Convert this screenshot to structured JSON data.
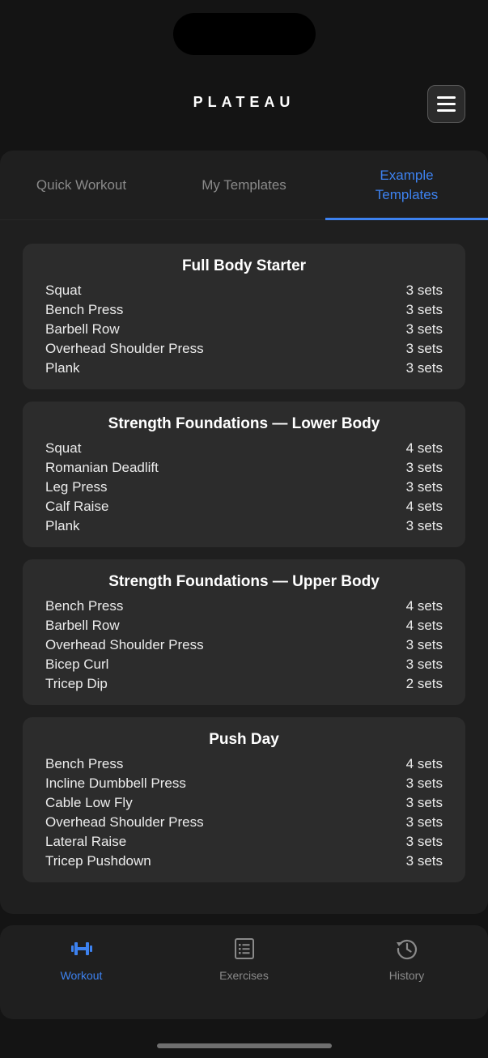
{
  "header": {
    "title": "PLATEAU"
  },
  "tabs": [
    {
      "label": "Quick Workout"
    },
    {
      "label": "My Templates"
    },
    {
      "label": "Example Templates"
    }
  ],
  "templates": [
    {
      "title": "Full Body Starter",
      "exercises": [
        {
          "name": "Squat",
          "sets": "3 sets"
        },
        {
          "name": "Bench Press",
          "sets": "3 sets"
        },
        {
          "name": "Barbell Row",
          "sets": "3 sets"
        },
        {
          "name": "Overhead Shoulder Press",
          "sets": "3 sets"
        },
        {
          "name": "Plank",
          "sets": "3 sets"
        }
      ]
    },
    {
      "title": "Strength Foundations — Lower Body",
      "exercises": [
        {
          "name": "Squat",
          "sets": "4 sets"
        },
        {
          "name": "Romanian Deadlift",
          "sets": "3 sets"
        },
        {
          "name": "Leg Press",
          "sets": "3 sets"
        },
        {
          "name": "Calf Raise",
          "sets": "4 sets"
        },
        {
          "name": "Plank",
          "sets": "3 sets"
        }
      ]
    },
    {
      "title": "Strength Foundations — Upper Body",
      "exercises": [
        {
          "name": "Bench Press",
          "sets": "4 sets"
        },
        {
          "name": "Barbell Row",
          "sets": "4 sets"
        },
        {
          "name": "Overhead Shoulder Press",
          "sets": "3 sets"
        },
        {
          "name": "Bicep Curl",
          "sets": "3 sets"
        },
        {
          "name": "Tricep Dip",
          "sets": "2 sets"
        }
      ]
    },
    {
      "title": "Push Day",
      "exercises": [
        {
          "name": "Bench Press",
          "sets": "4 sets"
        },
        {
          "name": "Incline Dumbbell Press",
          "sets": "3 sets"
        },
        {
          "name": "Cable Low Fly",
          "sets": "3 sets"
        },
        {
          "name": "Overhead Shoulder Press",
          "sets": "3 sets"
        },
        {
          "name": "Lateral Raise",
          "sets": "3 sets"
        },
        {
          "name": "Tricep Pushdown",
          "sets": "3 sets"
        }
      ]
    }
  ],
  "bottom_nav": [
    {
      "label": "Workout",
      "icon": "dumbbell-icon"
    },
    {
      "label": "Exercises",
      "icon": "list-icon"
    },
    {
      "label": "History",
      "icon": "history-icon"
    }
  ],
  "colors": {
    "accent": "#3d82f0",
    "background": "#141414",
    "panel": "#1f1f1f",
    "card": "#2c2c2c"
  }
}
